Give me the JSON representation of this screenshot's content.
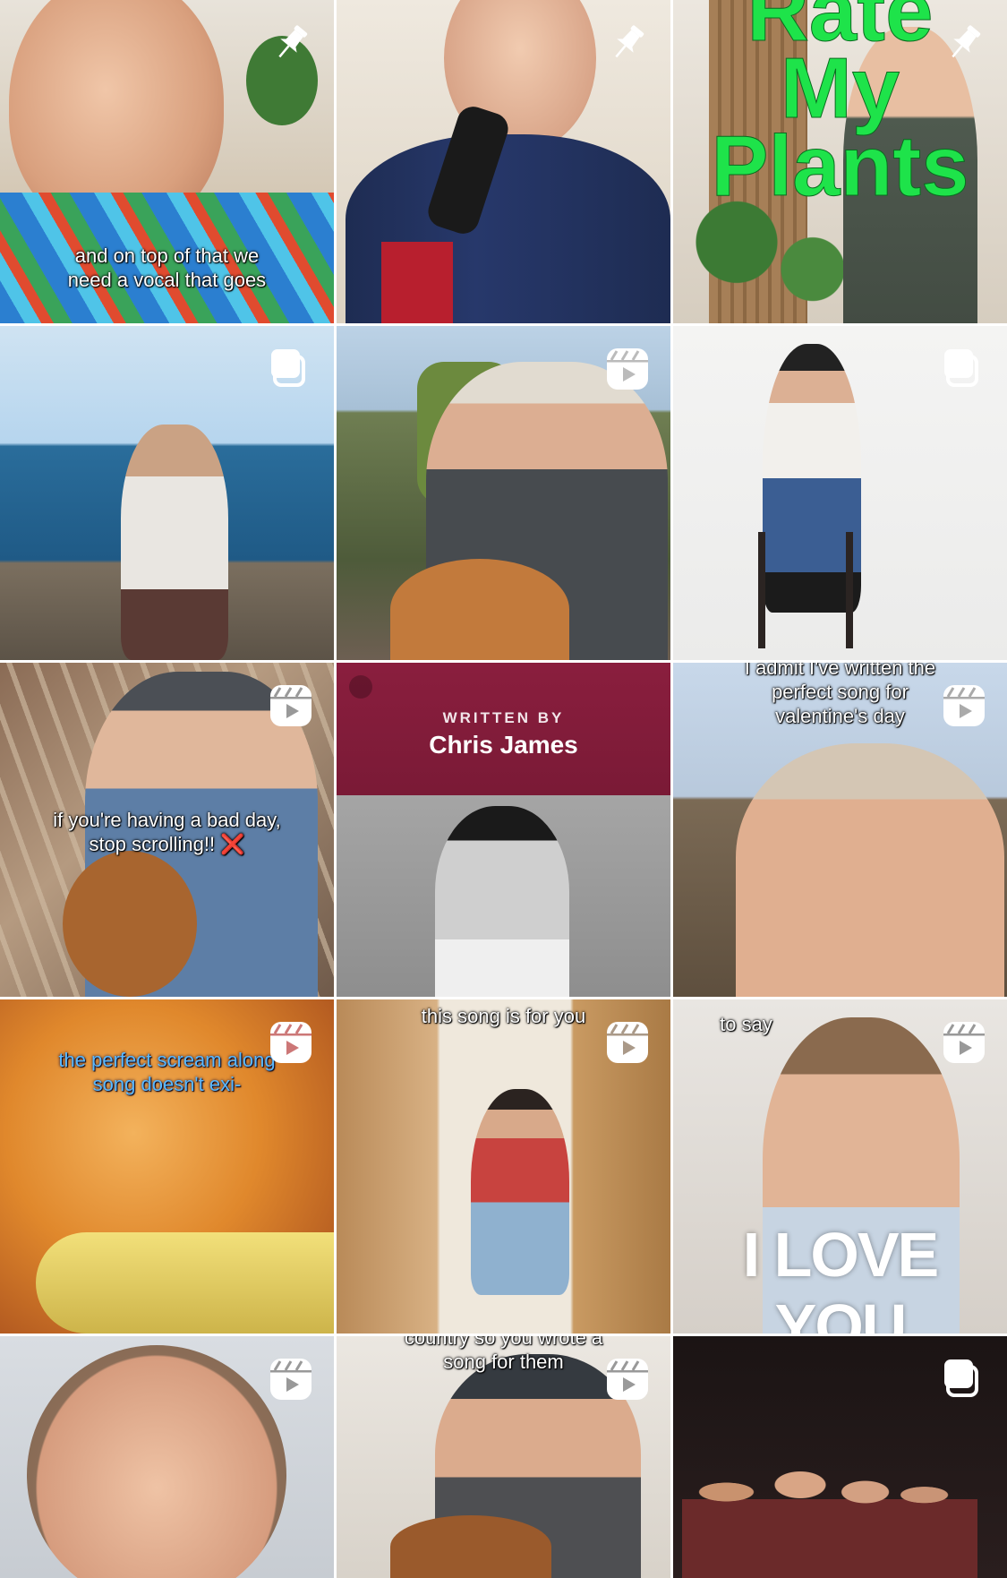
{
  "grid": {
    "tiles": [
      {
        "name": "post-1",
        "badge": "pin",
        "caption": "and on top of that we\nneed a vocal that goes"
      },
      {
        "name": "post-2",
        "badge": "pin",
        "caption": ""
      },
      {
        "name": "post-3",
        "badge": "pin",
        "title": "Rate\nMy\nPlants"
      },
      {
        "name": "post-4",
        "badge": "carousel",
        "caption": ""
      },
      {
        "name": "post-5",
        "badge": "reel",
        "caption": ""
      },
      {
        "name": "post-6",
        "badge": "carousel",
        "caption": ""
      },
      {
        "name": "post-7",
        "badge": "reel",
        "caption": "if you're having a bad day,\nstop scrolling!! ❌"
      },
      {
        "name": "post-8",
        "badge": "none",
        "written_by": "WRITTEN BY",
        "artist": "Chris James"
      },
      {
        "name": "post-9",
        "badge": "reel",
        "caption": "I admit I've written the\nperfect song for\nvalentine's day"
      },
      {
        "name": "post-10",
        "badge": "reel",
        "caption": "the perfect scream along\nsong doesn't exi-"
      },
      {
        "name": "post-11",
        "badge": "reel",
        "caption": "this song is for you"
      },
      {
        "name": "post-12",
        "badge": "reel",
        "caption": "to say",
        "big_text": "I LOVE YOU"
      },
      {
        "name": "post-13",
        "badge": "reel",
        "caption": ""
      },
      {
        "name": "post-14",
        "badge": "reel",
        "caption": "country so you wrote a\nsong for them"
      },
      {
        "name": "post-15",
        "badge": "carousel",
        "caption": ""
      }
    ]
  },
  "icons": {
    "pin": "pin-icon",
    "reel": "reel-icon",
    "carousel": "carousel-icon"
  },
  "colors": {
    "background": "#ffffff",
    "badge": "#ffffff",
    "caption_blue": "#5ab9ff",
    "title_green": "#1ee34a",
    "spotify_header": "#8a1e3e"
  }
}
